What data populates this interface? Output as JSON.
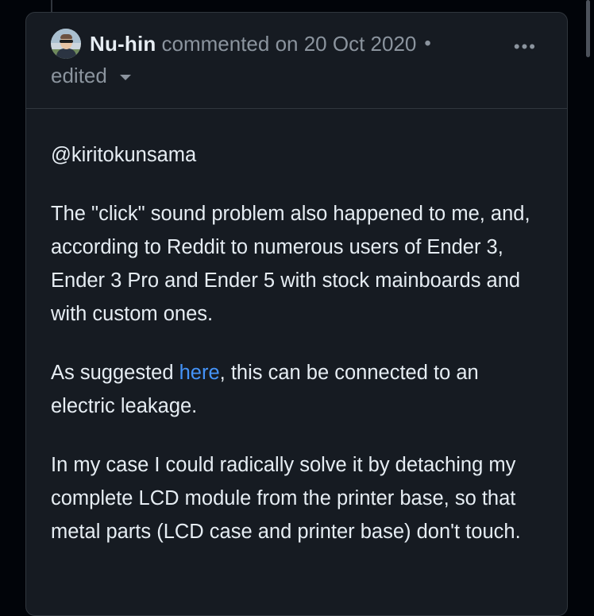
{
  "comment": {
    "author": "Nu-hin",
    "meta_text": "commented on 20 Oct 2020",
    "separator": "•",
    "edited_label": "edited",
    "more_options_icon": "kebab-horizontal-icon",
    "body": {
      "mention": "@kiritokunsama",
      "paragraph1": "The \"click\" sound problem also happened to me, and, according to Reddit to numerous users of Ender 3, Ender 3 Pro and Ender 5 with stock mainboards and with custom ones.",
      "paragraph2_before": "As suggested ",
      "paragraph2_link": "here",
      "paragraph2_after": ", this can be connected to an electric leakage.",
      "paragraph3": "In my case I could radically solve it by detaching my complete LCD module from the printer base, so that metal parts (LCD case and printer base) don't touch."
    }
  },
  "colors": {
    "background": "#010409",
    "card": "#161b22",
    "border": "#30363d",
    "text": "#e6edf3",
    "muted": "#8b949e",
    "link": "#4493f8"
  }
}
